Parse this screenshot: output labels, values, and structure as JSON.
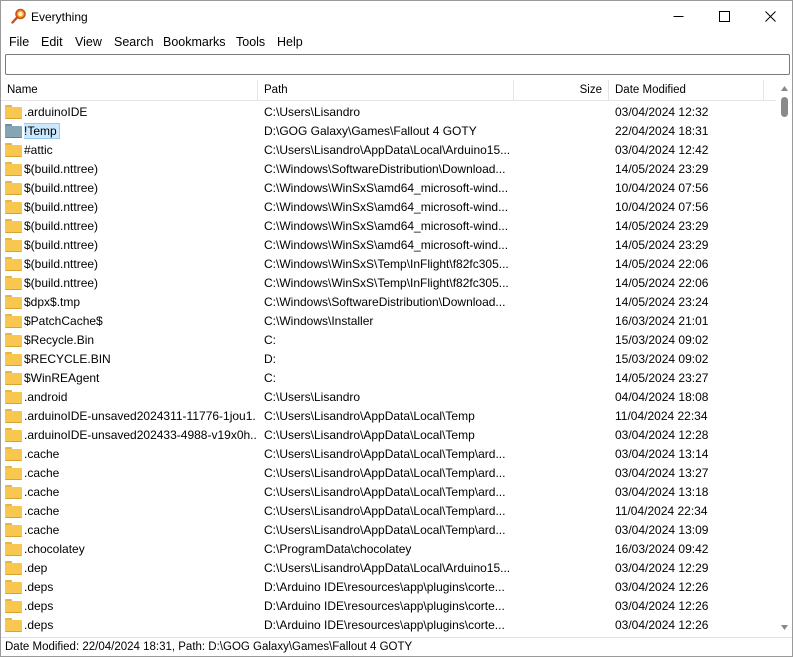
{
  "app": {
    "title": "Everything",
    "icon": "magnifier-icon"
  },
  "window_controls": {
    "minimize": "minimize-icon",
    "maximize": "maximize-icon",
    "close": "close-icon"
  },
  "menu": [
    "File",
    "Edit",
    "View",
    "Search",
    "Bookmarks",
    "Tools",
    "Help"
  ],
  "search": {
    "value": "",
    "placeholder": ""
  },
  "columns": {
    "name": "Name",
    "path": "Path",
    "size": "Size",
    "date": "Date Modified"
  },
  "colors": {
    "folder": "#f7c74f",
    "selected_folder": "#86a5b4",
    "selection": "#cce8ff"
  },
  "rows": [
    {
      "name": ".arduinoIDE",
      "path": "C:\\Users\\Lisandro",
      "date": "03/04/2024 12:32",
      "icon": "folder-icon"
    },
    {
      "name": "!Temp",
      "path": "D:\\GOG Galaxy\\Games\\Fallout 4 GOTY",
      "date": "22/04/2024 18:31",
      "icon": "folder-icon",
      "selected": true
    },
    {
      "name": "#attic",
      "path": "C:\\Users\\Lisandro\\AppData\\Local\\Arduino15...",
      "date": "03/04/2024 12:42",
      "icon": "folder-icon"
    },
    {
      "name": "$(build.nttree)",
      "path": "C:\\Windows\\SoftwareDistribution\\Download...",
      "date": "14/05/2024 23:29",
      "icon": "folder-icon"
    },
    {
      "name": "$(build.nttree)",
      "path": "C:\\Windows\\WinSxS\\amd64_microsoft-wind...",
      "date": "10/04/2024 07:56",
      "icon": "folder-icon"
    },
    {
      "name": "$(build.nttree)",
      "path": "C:\\Windows\\WinSxS\\amd64_microsoft-wind...",
      "date": "10/04/2024 07:56",
      "icon": "folder-icon"
    },
    {
      "name": "$(build.nttree)",
      "path": "C:\\Windows\\WinSxS\\amd64_microsoft-wind...",
      "date": "14/05/2024 23:29",
      "icon": "folder-icon"
    },
    {
      "name": "$(build.nttree)",
      "path": "C:\\Windows\\WinSxS\\amd64_microsoft-wind...",
      "date": "14/05/2024 23:29",
      "icon": "folder-icon"
    },
    {
      "name": "$(build.nttree)",
      "path": "C:\\Windows\\WinSxS\\Temp\\InFlight\\f82fc305...",
      "date": "14/05/2024 22:06",
      "icon": "folder-icon"
    },
    {
      "name": "$(build.nttree)",
      "path": "C:\\Windows\\WinSxS\\Temp\\InFlight\\f82fc305...",
      "date": "14/05/2024 22:06",
      "icon": "folder-icon"
    },
    {
      "name": "$dpx$.tmp",
      "path": "C:\\Windows\\SoftwareDistribution\\Download...",
      "date": "14/05/2024 23:24",
      "icon": "folder-icon"
    },
    {
      "name": "$PatchCache$",
      "path": "C:\\Windows\\Installer",
      "date": "16/03/2024 21:01",
      "icon": "folder-icon"
    },
    {
      "name": "$Recycle.Bin",
      "path": "C:",
      "date": "15/03/2024 09:02",
      "icon": "folder-icon"
    },
    {
      "name": "$RECYCLE.BIN",
      "path": "D:",
      "date": "15/03/2024 09:02",
      "icon": "folder-icon"
    },
    {
      "name": "$WinREAgent",
      "path": "C:",
      "date": "14/05/2024 23:27",
      "icon": "folder-icon"
    },
    {
      "name": ".android",
      "path": "C:\\Users\\Lisandro",
      "date": "04/04/2024 18:08",
      "icon": "folder-icon"
    },
    {
      "name": ".arduinoIDE-unsaved2024311-11776-1jou1...",
      "path": "C:\\Users\\Lisandro\\AppData\\Local\\Temp",
      "date": "11/04/2024 22:34",
      "icon": "folder-icon"
    },
    {
      "name": ".arduinoIDE-unsaved202433-4988-v19x0h...",
      "path": "C:\\Users\\Lisandro\\AppData\\Local\\Temp",
      "date": "03/04/2024 12:28",
      "icon": "folder-icon"
    },
    {
      "name": ".cache",
      "path": "C:\\Users\\Lisandro\\AppData\\Local\\Temp\\ard...",
      "date": "03/04/2024 13:14",
      "icon": "folder-icon"
    },
    {
      "name": ".cache",
      "path": "C:\\Users\\Lisandro\\AppData\\Local\\Temp\\ard...",
      "date": "03/04/2024 13:27",
      "icon": "folder-icon"
    },
    {
      "name": ".cache",
      "path": "C:\\Users\\Lisandro\\AppData\\Local\\Temp\\ard...",
      "date": "03/04/2024 13:18",
      "icon": "folder-icon"
    },
    {
      "name": ".cache",
      "path": "C:\\Users\\Lisandro\\AppData\\Local\\Temp\\ard...",
      "date": "11/04/2024 22:34",
      "icon": "folder-icon"
    },
    {
      "name": ".cache",
      "path": "C:\\Users\\Lisandro\\AppData\\Local\\Temp\\ard...",
      "date": "03/04/2024 13:09",
      "icon": "folder-icon"
    },
    {
      "name": ".chocolatey",
      "path": "C:\\ProgramData\\chocolatey",
      "date": "16/03/2024 09:42",
      "icon": "folder-icon"
    },
    {
      "name": ".dep",
      "path": "C:\\Users\\Lisandro\\AppData\\Local\\Arduino15...",
      "date": "03/04/2024 12:29",
      "icon": "folder-icon"
    },
    {
      "name": ".deps",
      "path": "D:\\Arduino IDE\\resources\\app\\plugins\\corte...",
      "date": "03/04/2024 12:26",
      "icon": "folder-icon"
    },
    {
      "name": ".deps",
      "path": "D:\\Arduino IDE\\resources\\app\\plugins\\corte...",
      "date": "03/04/2024 12:26",
      "icon": "folder-icon"
    },
    {
      "name": ".deps",
      "path": "D:\\Arduino IDE\\resources\\app\\plugins\\corte...",
      "date": "03/04/2024 12:26",
      "icon": "folder-icon"
    }
  ],
  "scrollbar": {
    "up": "scroll-up-arrow-icon",
    "down": "scroll-down-arrow-icon"
  },
  "status": "Date Modified: 22/04/2024 18:31, Path: D:\\GOG Galaxy\\Games\\Fallout 4 GOTY"
}
